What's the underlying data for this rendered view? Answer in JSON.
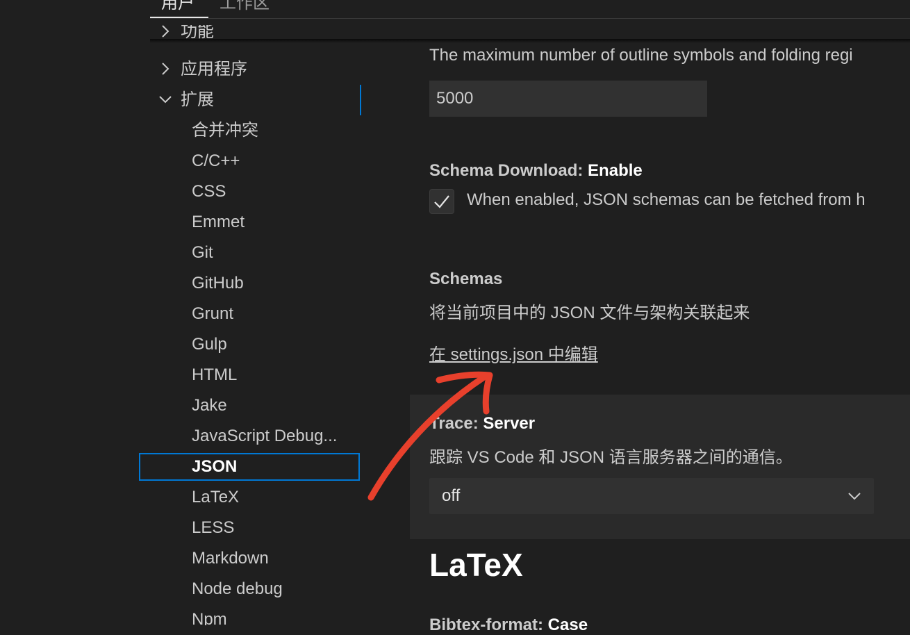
{
  "tabs": {
    "user": "用户",
    "workspace": "工作区"
  },
  "toc": {
    "items": [
      {
        "label": "功能",
        "kind": "group",
        "expanded": false
      },
      {
        "label": "应用程序",
        "kind": "group",
        "expanded": false
      },
      {
        "label": "扩展",
        "kind": "group",
        "expanded": true
      },
      {
        "label": "合并冲突",
        "kind": "child"
      },
      {
        "label": "C/C++",
        "kind": "child"
      },
      {
        "label": "CSS",
        "kind": "child"
      },
      {
        "label": "Emmet",
        "kind": "child"
      },
      {
        "label": "Git",
        "kind": "child"
      },
      {
        "label": "GitHub",
        "kind": "child"
      },
      {
        "label": "Grunt",
        "kind": "child"
      },
      {
        "label": "Gulp",
        "kind": "child"
      },
      {
        "label": "HTML",
        "kind": "child"
      },
      {
        "label": "Jake",
        "kind": "child"
      },
      {
        "label": "JavaScript Debug...",
        "kind": "child"
      },
      {
        "label": "JSON",
        "kind": "child",
        "selected": true
      },
      {
        "label": "LaTeX",
        "kind": "child"
      },
      {
        "label": "LESS",
        "kind": "child"
      },
      {
        "label": "Markdown",
        "kind": "child"
      },
      {
        "label": "Node debug",
        "kind": "child"
      },
      {
        "label": "Npm",
        "kind": "child"
      }
    ]
  },
  "settings": {
    "max_items": {
      "description": "The maximum number of outline symbols and folding regi",
      "value": "5000"
    },
    "schema_download": {
      "title_prefix": "Schema Download: ",
      "title_name": "Enable",
      "checked": true,
      "description": "When enabled, JSON schemas can be fetched from h"
    },
    "schemas": {
      "title": "Schemas",
      "description": "将当前项目中的 JSON 文件与架构关联起来",
      "link": "在 settings.json 中编辑"
    },
    "trace": {
      "title_prefix": "Trace: ",
      "title_name": "Server",
      "description": "跟踪 VS Code 和 JSON 语言服务器之间的通信。",
      "value": "off"
    },
    "next_section": {
      "title": "LaTeX",
      "first_setting_prefix": "Bibtex-format: ",
      "first_setting_name": "Case"
    }
  },
  "colors": {
    "background": "#1f1f1f",
    "accent": "#0078d4",
    "annotation_arrow": "#e8402c"
  }
}
